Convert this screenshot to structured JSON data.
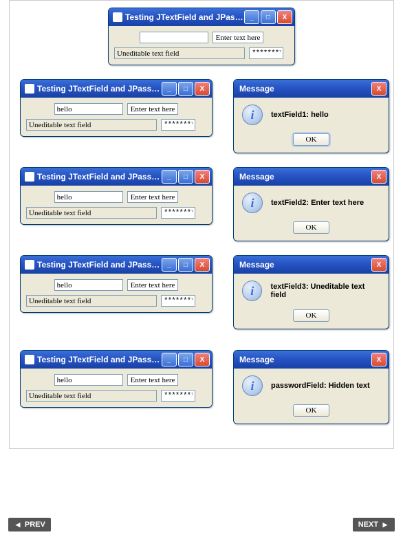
{
  "app": {
    "title": "Testing JTextField and JPasswor...",
    "enter_button": "Enter text here",
    "uneditable_label": "Uneditable text field",
    "password_value": "**********"
  },
  "rows": [
    {
      "field1": "",
      "msg": null
    },
    {
      "field1": "hello",
      "msg": "textField1: hello"
    },
    {
      "field1": "hello",
      "msg": "textField2: Enter text here"
    },
    {
      "field1": "hello",
      "msg": "textField3: Uneditable text field"
    },
    {
      "field1": "hello",
      "msg": "passwordField: Hidden text"
    }
  ],
  "dialog": {
    "title": "Message",
    "ok": "OK",
    "info": "i"
  },
  "nav": {
    "prev": "PREV",
    "next": "NEXT"
  },
  "win_btns": {
    "min": "_",
    "max": "□",
    "close": "X"
  }
}
